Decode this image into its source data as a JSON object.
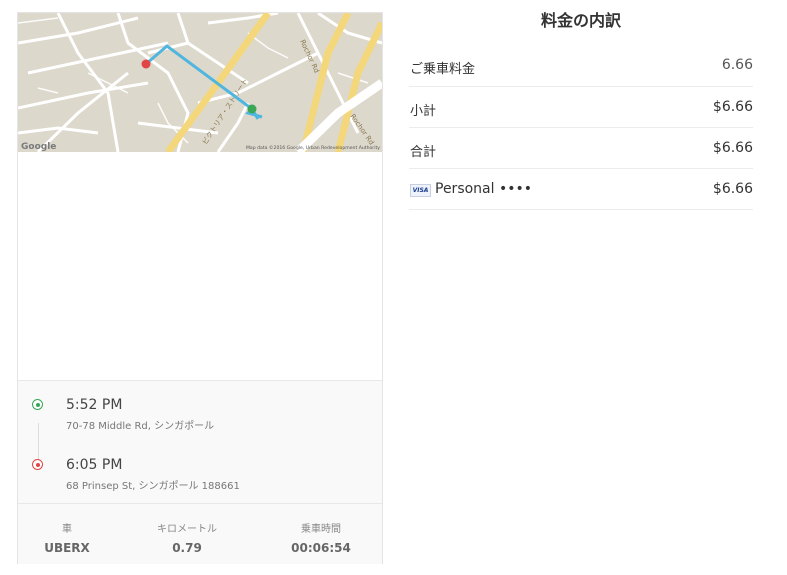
{
  "map": {
    "attribution": "Map data ©2016 Google, Urban Redevelopment Authority",
    "google_logo": "Google",
    "road_labels": [
      "Rochor Rd",
      "Rochor Rd",
      "ビクトリア・ストリート"
    ]
  },
  "trip": {
    "pickup": {
      "time": "5:52 PM",
      "address": "70-78 Middle Rd, シンガポール"
    },
    "dropoff": {
      "time": "6:05 PM",
      "address": "68 Prinsep St, シンガポール 188661"
    }
  },
  "stats": {
    "vehicle": {
      "label": "車",
      "value": "UBERX"
    },
    "distance": {
      "label": "キロメートル",
      "value": "0.79"
    },
    "duration": {
      "label": "乗車時間",
      "value": "00:06:54"
    }
  },
  "breakdown": {
    "title": "料金の内訳",
    "rows": [
      {
        "label": "ご乗車料金",
        "amount": "6.66"
      },
      {
        "label": "小計",
        "amount": "$6.66"
      },
      {
        "label": "合計",
        "amount": "$6.66"
      },
      {
        "label": "Personal ••••",
        "amount": "$6.66",
        "card_brand": "VISA"
      }
    ]
  },
  "colors": {
    "route": "#4fb6e0",
    "pickup_marker": "#3aa757",
    "dropoff_marker": "#e04646",
    "map_bg": "#ddd8cc",
    "major_road": "#f3d77a"
  }
}
